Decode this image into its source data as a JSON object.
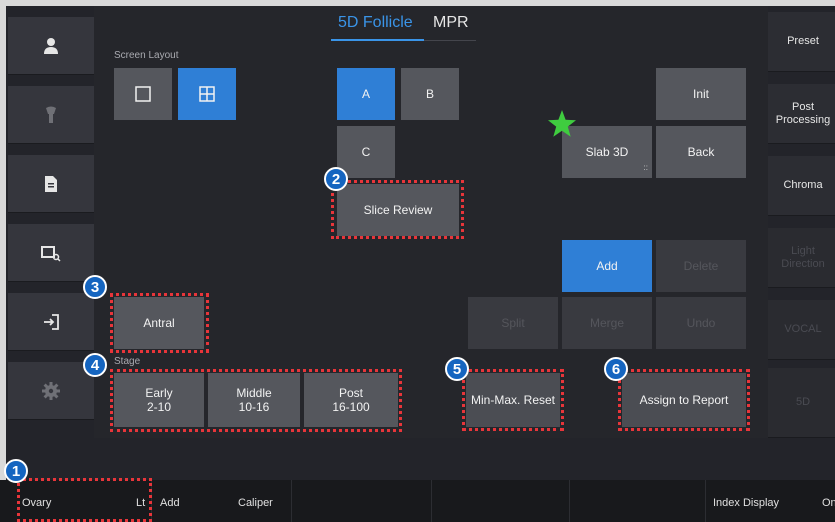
{
  "tabs": {
    "active": "5D Follicle",
    "inactive": "MPR"
  },
  "left_sidebar": {
    "items": [
      {
        "icon": "user-icon"
      },
      {
        "icon": "probe-icon"
      },
      {
        "icon": "document-icon"
      },
      {
        "icon": "image-search-icon"
      },
      {
        "icon": "exit-icon"
      },
      {
        "icon": "gear-icon"
      }
    ]
  },
  "right_sidebar": {
    "items": [
      {
        "label": "Preset"
      },
      {
        "label": "Post\nProcessing"
      },
      {
        "label": "Chroma"
      },
      {
        "label": "Light\nDirection"
      },
      {
        "label": "VOCAL"
      },
      {
        "label": "5D"
      }
    ]
  },
  "screen_layout": {
    "label": "Screen Layout"
  },
  "view_buttons": {
    "a": "A",
    "b": "B",
    "c": "C"
  },
  "slice_review": "Slice Review",
  "init": "Init",
  "slab_3d": "Slab 3D",
  "grip_mark": "::",
  "back": "Back",
  "add": "Add",
  "delete": "Delete",
  "split": "Split",
  "merge": "Merge",
  "undo": "Undo",
  "antral": "Antral",
  "stage": {
    "label": "Stage",
    "early": "Early\n2-10",
    "middle": "Middle\n10-16",
    "post": "Post\n16-100"
  },
  "min_max_reset": "Min-Max. Reset",
  "assign_to_report": "Assign to Report",
  "badges": [
    "1",
    "2",
    "3",
    "4",
    "5",
    "6"
  ],
  "bottom_bar": {
    "ovary": "Ovary",
    "side": "Lt",
    "add": "Add",
    "caliper": "Caliper",
    "index_display": "Index Display",
    "on": "On"
  },
  "colors": {
    "accent": "#2f7fd6",
    "highlight": "#e8353a",
    "badge": "#1565c0",
    "star": "#3fcc3f"
  }
}
